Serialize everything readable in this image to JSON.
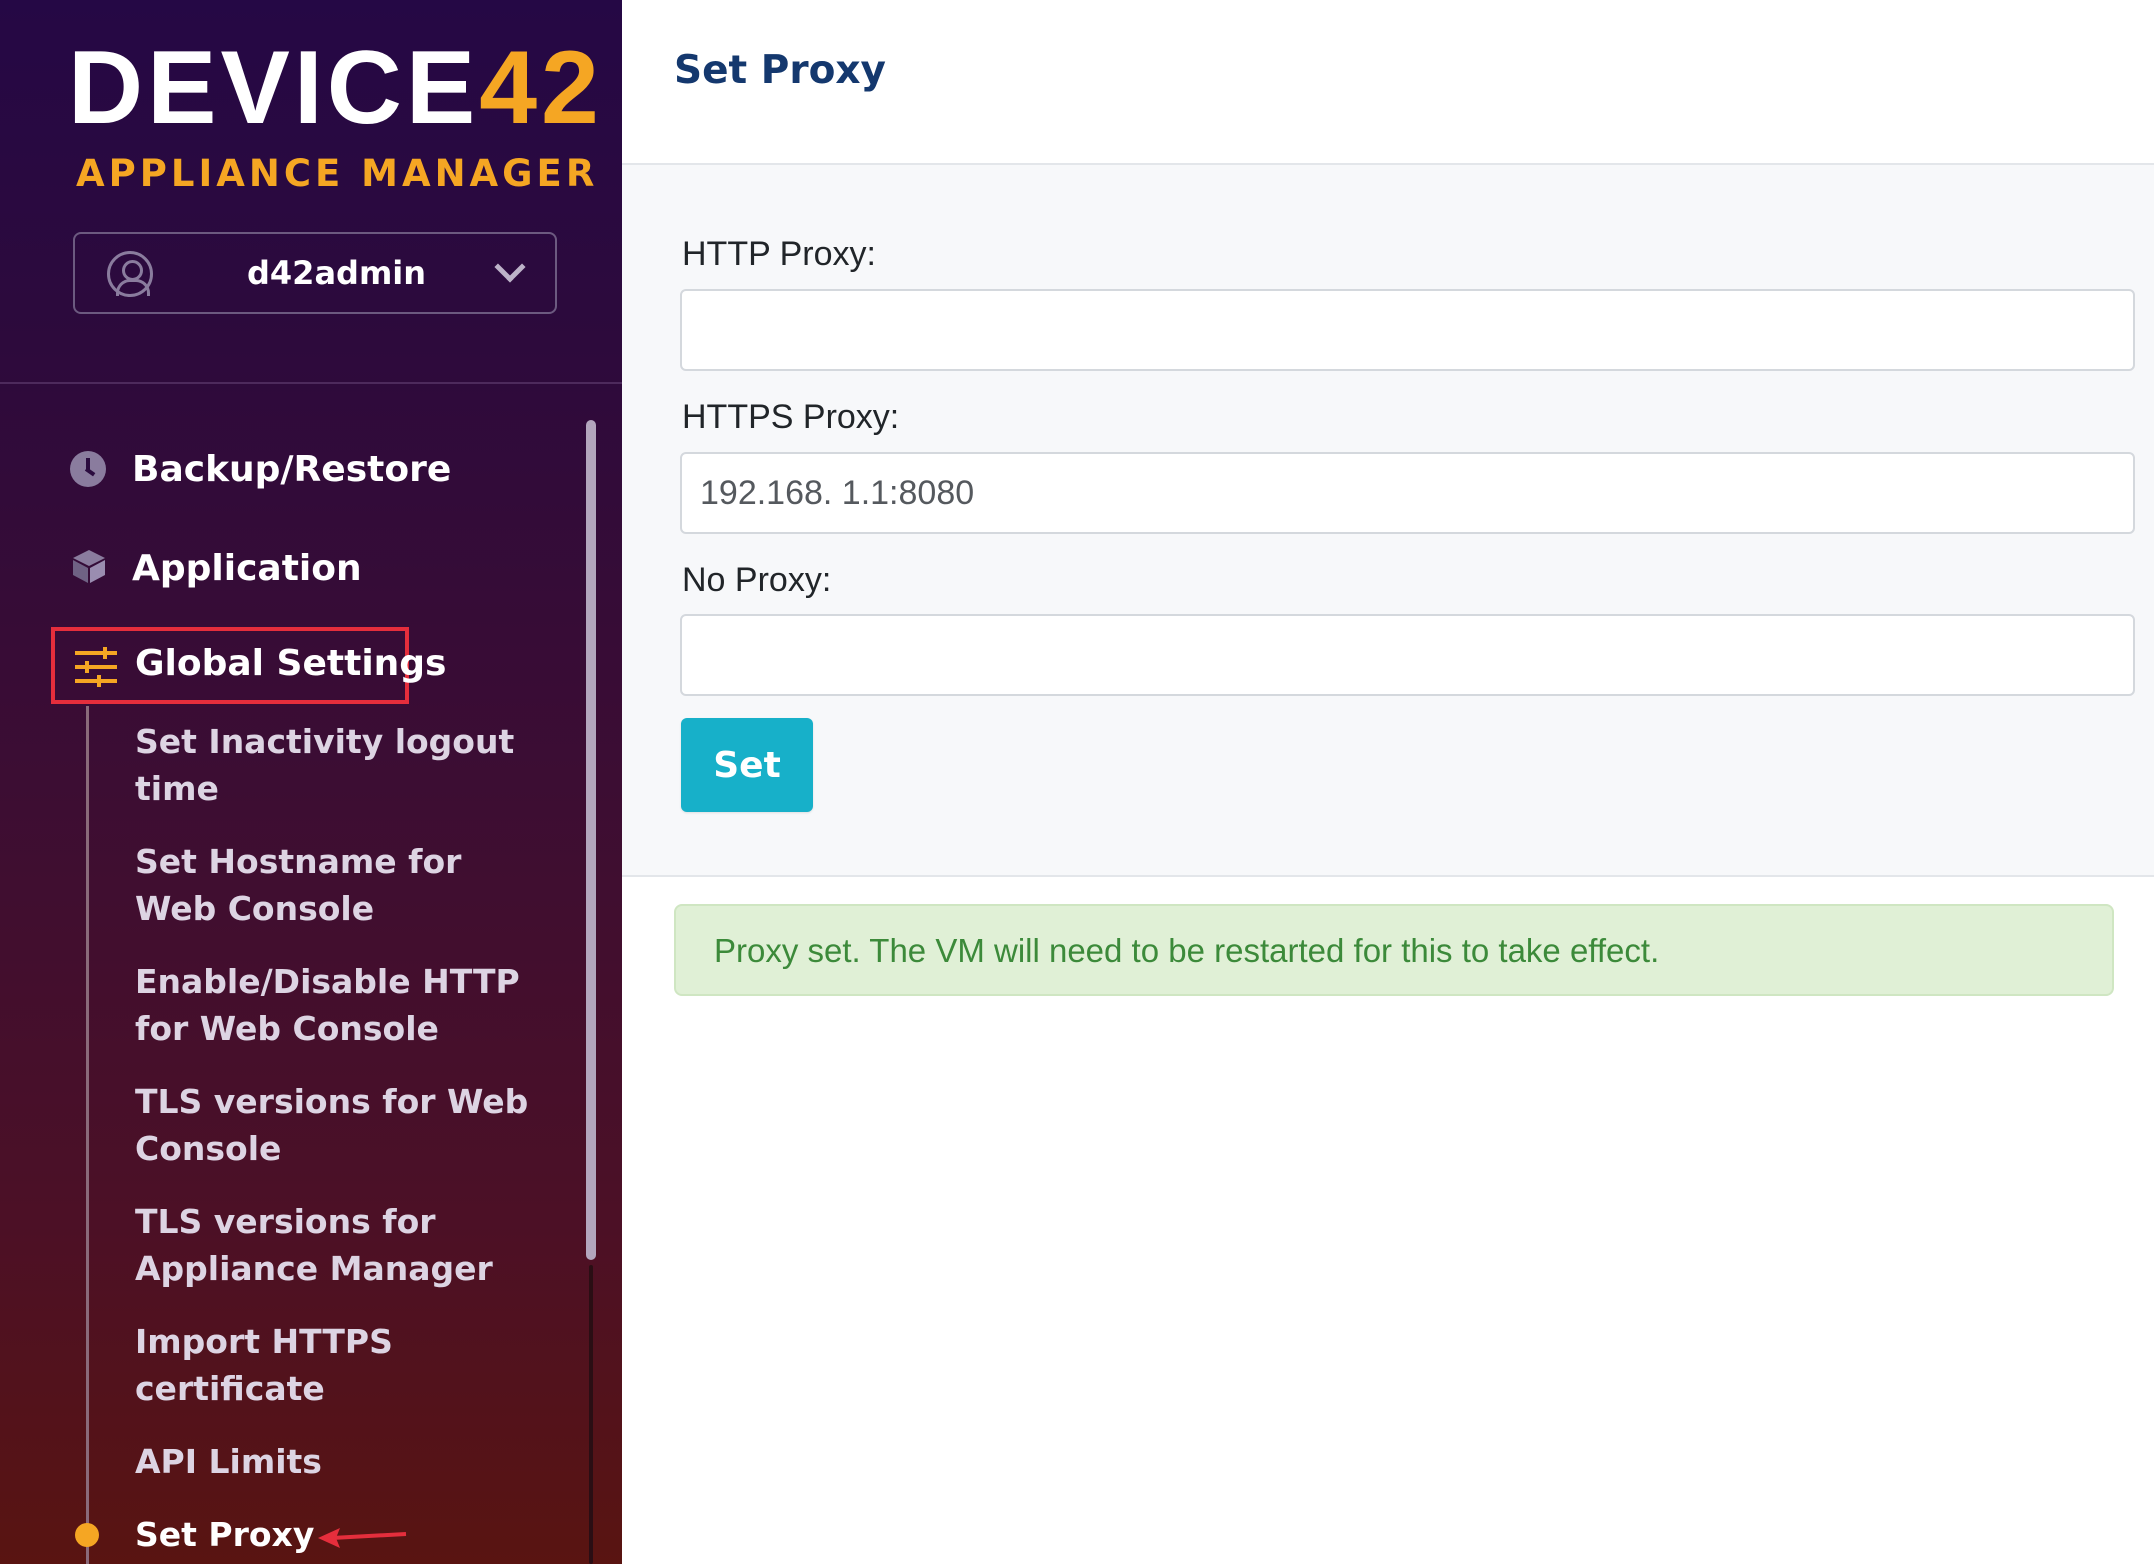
{
  "sidebar": {
    "logo_text": "DEVICE",
    "logo_number": "42",
    "subtitle": "APPLIANCE MANAGER",
    "user": {
      "name": "d42admin",
      "avatar_icon": "user-circle-icon",
      "dropdown_icon": "chevron-down-icon"
    },
    "nav": [
      {
        "label": "Backup/Restore",
        "icon": "clock-icon"
      },
      {
        "label": "Application",
        "icon": "box-icon"
      },
      {
        "label": "Global Settings",
        "icon": "sliders-icon",
        "highlighted": true
      }
    ],
    "global_settings_items": [
      {
        "label": "Set Inactivity logout time"
      },
      {
        "label": "Set Hostname for Web Console"
      },
      {
        "label": "Enable/Disable HTTP for Web Console"
      },
      {
        "label": "TLS versions for Web Console"
      },
      {
        "label": "TLS versions for Appliance Manager"
      },
      {
        "label": "Import HTTPS certificate"
      },
      {
        "label": "API Limits"
      },
      {
        "label": "Set Proxy",
        "active": true
      }
    ]
  },
  "main": {
    "title": "Set Proxy",
    "form": {
      "http_label": "HTTP Proxy:",
      "http_value": "",
      "https_label": "HTTPS Proxy:",
      "https_value": "192.168. 1.1:8080",
      "no_proxy_label": "No Proxy:",
      "no_proxy_value": "",
      "submit_label": "Set"
    },
    "alert": "Proxy set. The VM will need to be restarted for this to take effect."
  },
  "colors": {
    "accent": "#f5a623",
    "button": "#17b0c9",
    "title": "#14386e",
    "success_bg": "#e0f0d6",
    "success_text": "#3c8a3a",
    "highlight_border": "#e52e3c"
  }
}
